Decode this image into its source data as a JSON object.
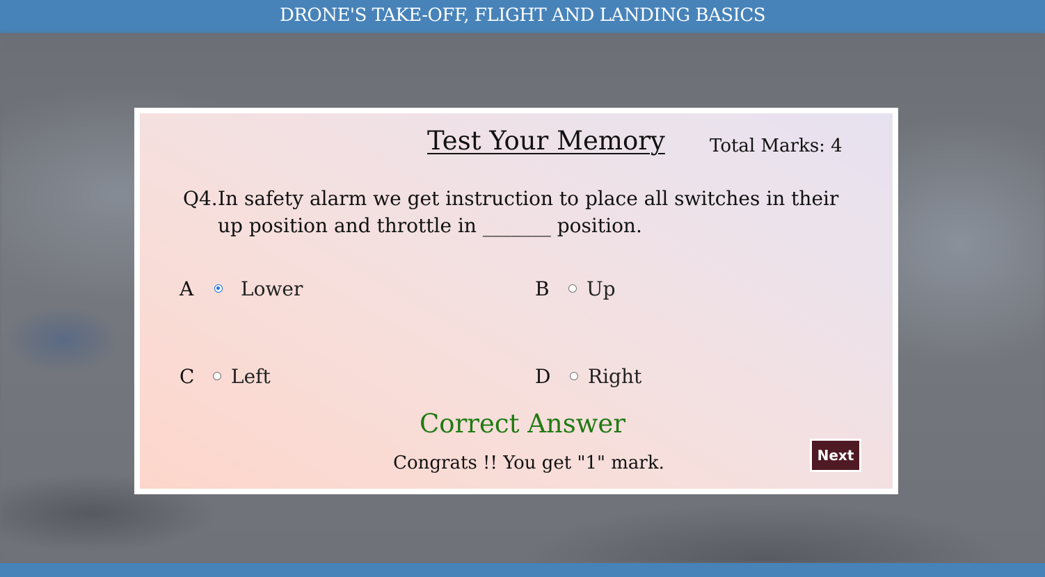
{
  "header": {
    "title": "DRONE'S TAKE-OFF, FLIGHT AND LANDING BASICS"
  },
  "quiz": {
    "title": "Test Your Memory",
    "total_marks": "Total Marks:  4",
    "question": {
      "number": "Q4.",
      "text": "In safety alarm we get instruction to place all switches in their up position and throttle in _______ position."
    },
    "options": [
      {
        "letter": "A",
        "label": "Lower",
        "selected": true
      },
      {
        "letter": "B",
        "label": "Up",
        "selected": false
      },
      {
        "letter": "C",
        "label": "Left",
        "selected": false
      },
      {
        "letter": "D",
        "label": "Right",
        "selected": false
      }
    ],
    "result": {
      "title": "Correct Answer",
      "message": "Congrats !! You get \"1\" mark."
    },
    "next_label": "Next"
  },
  "colors": {
    "header_bg": "#4783b9",
    "result_green": "#1f7a12",
    "next_button_bg": "#4f1a24",
    "radio_selected": "#1a73e8"
  }
}
